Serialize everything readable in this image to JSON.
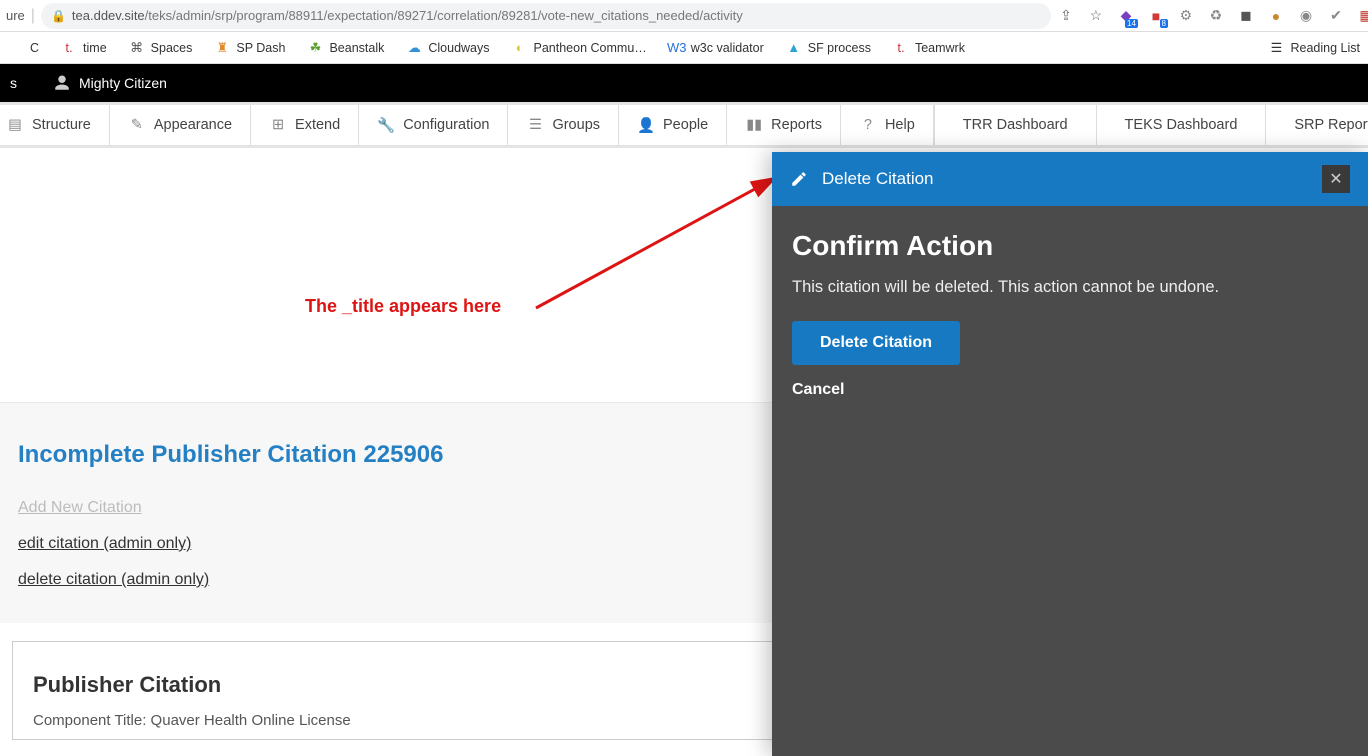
{
  "browser": {
    "url_prefix": "ure",
    "host": "tea.ddev.site",
    "path": "/teks/admin/srp/program/88911/expectation/89271/correlation/89281/vote-new_citations_needed/activity",
    "icons": [
      {
        "name": "share-icon",
        "glyph": "⇪"
      },
      {
        "name": "star-icon",
        "glyph": "☆"
      },
      {
        "name": "ext-purple-icon",
        "glyph": "◆",
        "color": "#7b3fbf",
        "badge": "14"
      },
      {
        "name": "ext-red-icon",
        "glyph": "■",
        "color": "#cf3a3a",
        "badge": "8"
      },
      {
        "name": "gear-gray-icon",
        "glyph": "⚙",
        "color": "#888"
      },
      {
        "name": "recycle-icon",
        "glyph": "♻",
        "color": "#888"
      },
      {
        "name": "square-dark-icon",
        "glyph": "◼",
        "color": "#555"
      },
      {
        "name": "cookie-icon",
        "glyph": "●",
        "color": "#c78a2f"
      },
      {
        "name": "camera-icon",
        "glyph": "◉",
        "color": "#888"
      },
      {
        "name": "check-icon",
        "glyph": "✔",
        "color": "#888"
      },
      {
        "name": "grid-icon",
        "glyph": "▦",
        "color": "#c0392b"
      },
      {
        "name": "triangle-icon",
        "glyph": "△",
        "color": "#2a6fd6"
      },
      {
        "name": "puzzle-icon",
        "glyph": "✦",
        "color": "#555"
      },
      {
        "name": "profile-icon",
        "glyph": "●",
        "color": "#bbb"
      },
      {
        "name": "menu-dots-icon",
        "glyph": "⋮",
        "color": "#666"
      }
    ]
  },
  "bookmarks": {
    "items": [
      {
        "label": "C",
        "icon": ""
      },
      {
        "label": "time",
        "icon": "t.",
        "color": "#cf3a3a"
      },
      {
        "label": "Spaces",
        "icon": "⌘",
        "color": "#555"
      },
      {
        "label": "SP Dash",
        "icon": "♜",
        "color": "#e08a2f"
      },
      {
        "label": "Beanstalk",
        "icon": "☘",
        "color": "#5aa02c"
      },
      {
        "label": "Cloudways",
        "icon": "☁",
        "color": "#3292d8"
      },
      {
        "label": "Pantheon Commu…",
        "icon": "◐",
        "color": "#e7c140"
      },
      {
        "label": "w3c validator",
        "icon": "W3",
        "color": "#2a6fd6"
      },
      {
        "label": "SF process",
        "icon": "▲",
        "color": "#2aa3d8"
      },
      {
        "label": "Teamwrk",
        "icon": "t.",
        "color": "#cf3a3a"
      }
    ],
    "reading_list": "Reading List"
  },
  "drupal": {
    "left_cut": "s",
    "user": "Mighty Citizen"
  },
  "admin_menu": {
    "items": [
      {
        "label": "Structure",
        "icon": "▤"
      },
      {
        "label": "Appearance",
        "icon": "✎"
      },
      {
        "label": "Extend",
        "icon": "⊞"
      },
      {
        "label": "Configuration",
        "icon": "🔧"
      },
      {
        "label": "Groups",
        "icon": "☰"
      },
      {
        "label": "People",
        "icon": "👤"
      },
      {
        "label": "Reports",
        "icon": "▮▮"
      },
      {
        "label": "Help",
        "icon": "?"
      }
    ],
    "dashboards": [
      "TRR Dashboard",
      "TEKS Dashboard",
      "SRP Reports"
    ]
  },
  "annotation": "The _title appears here",
  "citation": {
    "heading": "Incomplete Publisher Citation 225906",
    "links": [
      {
        "label": "Add New Citation",
        "disabled": true
      },
      {
        "label": "edit citation (admin only)",
        "disabled": false
      },
      {
        "label": "delete citation (admin only)",
        "disabled": false
      }
    ],
    "pub_heading": "Publisher Citation",
    "pub_sub": "Component Title: Quaver Health Online License"
  },
  "panel": {
    "header": "Delete Citation",
    "title": "Confirm Action",
    "body": "This citation will be deleted. This action cannot be undone.",
    "primary": "Delete Citation",
    "cancel": "Cancel"
  }
}
